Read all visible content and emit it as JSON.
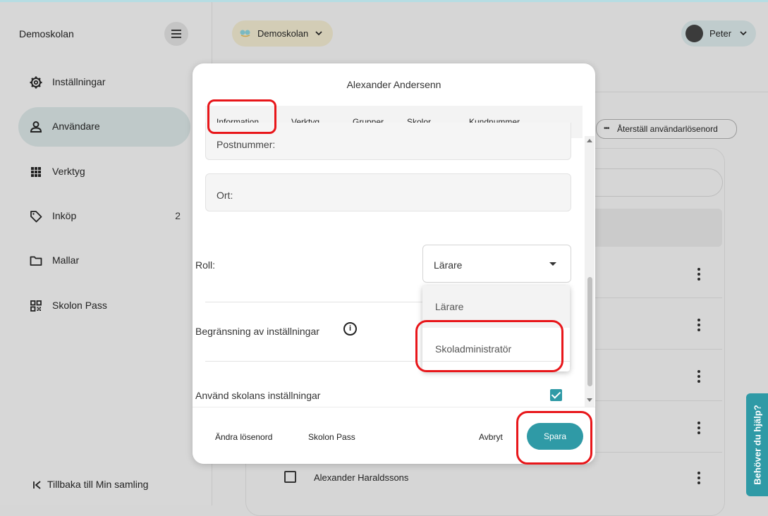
{
  "sidebar": {
    "brand": "Demoskolan",
    "items": [
      {
        "label": "Inställningar",
        "icon": "gear-icon"
      },
      {
        "label": "Användare",
        "icon": "user-icon",
        "active": true
      },
      {
        "label": "Verktyg",
        "icon": "grid-icon"
      },
      {
        "label": "Inköp",
        "icon": "tag-icon",
        "count": "2"
      },
      {
        "label": "Mallar",
        "icon": "folder-icon"
      },
      {
        "label": "Skolon Pass",
        "icon": "qr-icon"
      }
    ],
    "back_label": "Tillbaka till Min samling"
  },
  "header": {
    "school": "Demoskolan",
    "user": "Peter"
  },
  "main": {
    "reset_password_label": "Återställ användarlösenord",
    "row_name": "Alexander Haraldssons"
  },
  "modal": {
    "title": "Alexander Andersenn",
    "tabs": [
      "Information",
      "Verktyg",
      "Grupper",
      "Skolor",
      "Kundnummer"
    ],
    "postal_label": "Postnummer:",
    "city_label": "Ort:",
    "role_label": "Roll:",
    "role_value": "Lärare",
    "role_options": [
      "Lärare",
      "Skoladministratör"
    ],
    "restriction_label": "Begränsning av inställningar",
    "use_school_settings_label": "Använd skolans inställningar",
    "use_school_settings_checked": true,
    "footer": {
      "change_password": "Ändra lösenord",
      "skolon_pass": "Skolon Pass",
      "cancel": "Avbryt",
      "save": "Spara"
    }
  },
  "help_tab": "Behöver du hjälp?",
  "colors": {
    "accent": "#2f9aa6",
    "annotation": "#e8161a"
  }
}
